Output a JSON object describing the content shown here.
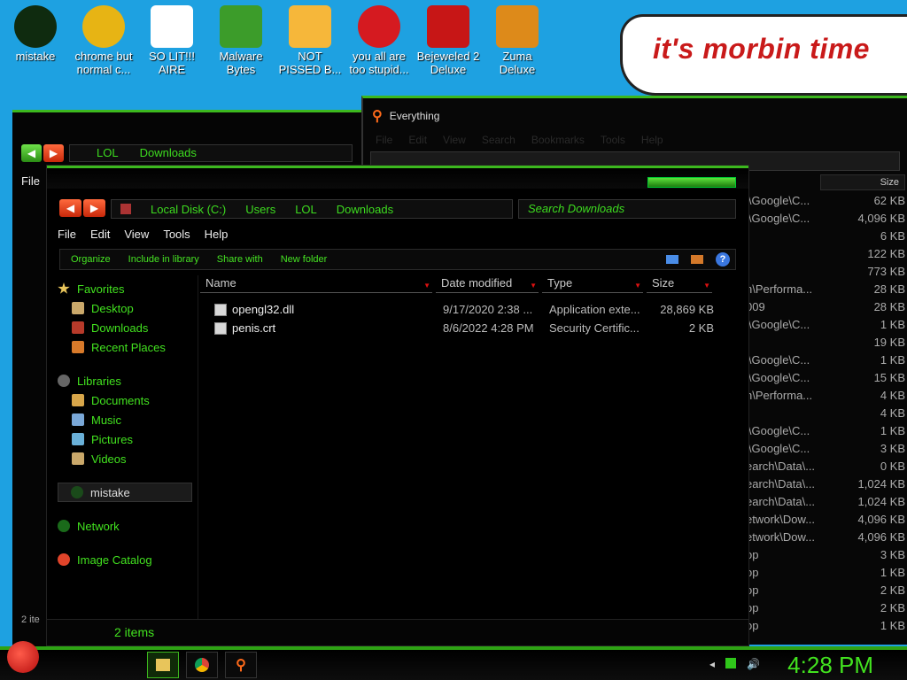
{
  "desktop_icons": [
    {
      "label1": "mistake",
      "label2": "",
      "color": "#0f2b0f"
    },
    {
      "label1": "chrome but",
      "label2": "normal c...",
      "color": "#e7b414"
    },
    {
      "label1": "SO LIT!!!",
      "label2": "AIRE",
      "color": "#ffffff"
    },
    {
      "label1": "Malware",
      "label2": "Bytes",
      "color": "#3c9c2a"
    },
    {
      "label1": "NOT",
      "label2": "PISSED B...",
      "color": "#f6b73a"
    },
    {
      "label1": "you all are",
      "label2": "too stupid...",
      "color": "#d51a20"
    },
    {
      "label1": "Bejeweled 2",
      "label2": "Deluxe",
      "color": "#c71616"
    },
    {
      "label1": "Zuma",
      "label2": "Deluxe",
      "color": "#dd8a1a"
    }
  ],
  "note": {
    "text": "it's morbin time"
  },
  "everything": {
    "title": "Everything",
    "menu": [
      "File",
      "Edit",
      "View",
      "Search",
      "Bookmarks",
      "Tools",
      "Help"
    ],
    "size_header": "Size",
    "rows": [
      {
        "path": "l\\Google\\C...",
        "size": "62 KB"
      },
      {
        "path": "l\\Google\\C...",
        "size": "4,096 KB"
      },
      {
        "path": "",
        "size": "6 KB"
      },
      {
        "path": "",
        "size": "122 KB"
      },
      {
        "path": "",
        "size": "773 KB"
      },
      {
        "path": "n\\Performa...",
        "size": "28 KB"
      },
      {
        "path": "009",
        "size": "28 KB"
      },
      {
        "path": "l\\Google\\C...",
        "size": "1 KB"
      },
      {
        "path": "",
        "size": "19 KB"
      },
      {
        "path": "l\\Google\\C...",
        "size": "1 KB"
      },
      {
        "path": "l\\Google\\C...",
        "size": "15 KB"
      },
      {
        "path": "n\\Performa...",
        "size": "4 KB"
      },
      {
        "path": "",
        "size": "4 KB"
      },
      {
        "path": "l\\Google\\C...",
        "size": "1 KB"
      },
      {
        "path": "l\\Google\\C...",
        "size": "3 KB"
      },
      {
        "path": "earch\\Data\\...",
        "size": "0 KB"
      },
      {
        "path": "earch\\Data\\...",
        "size": "1,024 KB"
      },
      {
        "path": "earch\\Data\\...",
        "size": "1,024 KB"
      },
      {
        "path": "etwork\\Dow...",
        "size": "4,096 KB"
      },
      {
        "path": "etwork\\Dow...",
        "size": "4,096 KB"
      },
      {
        "path": "op",
        "size": "3 KB"
      },
      {
        "path": "op",
        "size": "1 KB"
      },
      {
        "path": "op",
        "size": "2 KB"
      },
      {
        "path": "op",
        "size": "2 KB"
      },
      {
        "path": "op",
        "size": "1 KB"
      }
    ]
  },
  "back_window": {
    "breadcrumb1": "LOL",
    "breadcrumb2": "Downloads",
    "menu_file": "File",
    "status": "2 ite"
  },
  "explorer": {
    "breadcrumbs": [
      "Local Disk (C:)",
      "Users",
      "LOL",
      "Downloads"
    ],
    "search_placeholder": "Search Downloads",
    "menu": [
      "File",
      "Edit",
      "View",
      "Tools",
      "Help"
    ],
    "commands": [
      "Organize",
      "Include in library",
      "Share with",
      "New folder"
    ],
    "nav": {
      "favorites": "Favorites",
      "fav_items": [
        "Desktop",
        "Downloads",
        "Recent Places"
      ],
      "libraries": "Libraries",
      "lib_items": [
        "Documents",
        "Music",
        "Pictures",
        "Videos"
      ],
      "homegroup": "mistake",
      "network": "Network",
      "image_catalog": "Image Catalog"
    },
    "columns": [
      "Name",
      "Date modified",
      "Type",
      "Size"
    ],
    "files": [
      {
        "name": "opengl32.dll",
        "date": "9/17/2020 2:38 ...",
        "type": "Application exte...",
        "size": "28,869 KB"
      },
      {
        "name": "penis.crt",
        "date": "8/6/2022 4:28 PM",
        "type": "Security Certific...",
        "size": "2 KB"
      }
    ],
    "status": "2 items"
  },
  "taskbar": {
    "clock": "4:28 PM"
  },
  "colors": {
    "accent": "#42e21f",
    "desktop": "#1ea1e1",
    "window": "#000000"
  }
}
